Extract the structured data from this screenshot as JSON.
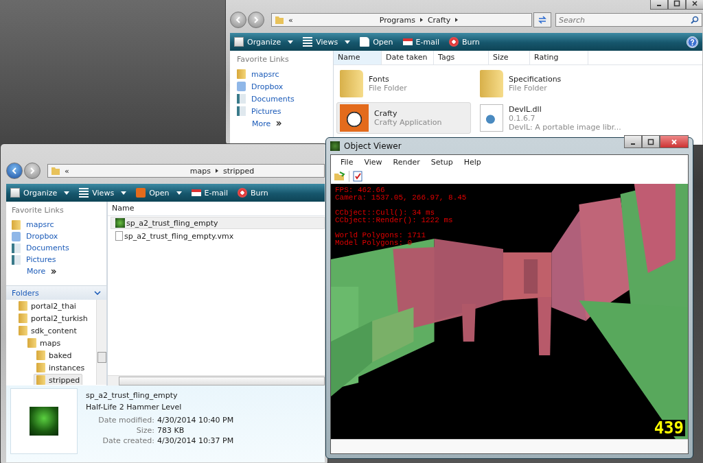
{
  "back_window": {
    "address": [
      "«",
      "Programs",
      "Crafty"
    ],
    "search": {
      "placeholder": "Search"
    },
    "toolbar": [
      {
        "label": "Organize",
        "kind": "organize",
        "dropdown": true
      },
      {
        "label": "Views",
        "kind": "views",
        "dropdown": true
      },
      {
        "label": "Open",
        "kind": "open",
        "dropdown": false
      },
      {
        "label": "E-mail",
        "kind": "email",
        "dropdown": false
      },
      {
        "label": "Burn",
        "kind": "burn",
        "dropdown": false
      }
    ],
    "favorite_links": {
      "title": "Favorite Links",
      "items": [
        {
          "label": "mapsrc",
          "kind": "folder"
        },
        {
          "label": "Dropbox",
          "kind": "dropbox"
        },
        {
          "label": "Documents",
          "kind": "documents"
        },
        {
          "label": "Pictures",
          "kind": "pictures"
        }
      ],
      "more": "More"
    },
    "columns": [
      "Name",
      "Date taken",
      "Tags",
      "Size",
      "Rating"
    ],
    "files": [
      {
        "name": "Fonts",
        "details": [
          "File Folder"
        ],
        "kind": "folder",
        "selected": false
      },
      {
        "name": "Specifications",
        "details": [
          "File Folder"
        ],
        "kind": "folder",
        "selected": false
      },
      {
        "name": "Crafty",
        "details": [
          "Crafty Application"
        ],
        "kind": "app",
        "selected": true
      },
      {
        "name": "DevIL.dll",
        "details": [
          "0.1.6.7",
          "DevIL: A portable image libr..."
        ],
        "kind": "dll",
        "selected": false
      }
    ]
  },
  "front_window": {
    "address": [
      "«",
      "maps",
      "stripped"
    ],
    "toolbar": [
      {
        "label": "Organize",
        "kind": "organize",
        "dropdown": true
      },
      {
        "label": "Views",
        "kind": "views",
        "dropdown": true
      },
      {
        "label": "Open",
        "kind": "app",
        "dropdown": true
      },
      {
        "label": "E-mail",
        "kind": "email",
        "dropdown": false
      },
      {
        "label": "Burn",
        "kind": "burn",
        "dropdown": false
      }
    ],
    "favorite_links": {
      "title": "Favorite Links",
      "items": [
        {
          "label": "mapsrc",
          "kind": "folder"
        },
        {
          "label": "Dropbox",
          "kind": "dropbox"
        },
        {
          "label": "Documents",
          "kind": "documents"
        },
        {
          "label": "Pictures",
          "kind": "pictures"
        }
      ],
      "more": "More"
    },
    "folders": {
      "title": "Folders",
      "items": [
        {
          "label": "portal2_thai",
          "selected": false
        },
        {
          "label": "portal2_turkish",
          "selected": false
        },
        {
          "label": "sdk_content",
          "selected": false,
          "children": [
            {
              "label": "maps",
              "selected": false,
              "children": [
                {
                  "label": "baked",
                  "selected": false
                },
                {
                  "label": "instances",
                  "selected": false
                },
                {
                  "label": "stripped",
                  "selected": true
                }
              ]
            }
          ]
        }
      ]
    },
    "columns": [
      "Name"
    ],
    "files": [
      {
        "name": "sp_a2_trust_fling_empty",
        "kind": "level",
        "selected": true
      },
      {
        "name": "sp_a2_trust_fling_empty.vmx",
        "kind": "file",
        "selected": false
      }
    ],
    "details_pane": {
      "name": "sp_a2_trust_fling_empty",
      "type": "Half-Life 2 Hammer Level",
      "fields": [
        {
          "label": "Date modified:",
          "value": "4/30/2014 10:40 PM"
        },
        {
          "label": "Size:",
          "value": "783 KB"
        },
        {
          "label": "Date created:",
          "value": "4/30/2014 10:37 PM"
        }
      ]
    }
  },
  "object_viewer": {
    "title": "Object Viewer",
    "menu": [
      "File",
      "View",
      "Render",
      "Setup",
      "Help"
    ],
    "overlay": [
      [
        "FPS: 462.66",
        "Camera: 1537.05, 266.97, 8.45"
      ],
      [
        "CCbject::Cull(): 34 ms",
        "CCbject::Render(): 1222 ms"
      ],
      [
        "World Polygons: 1711",
        "Model Polygons: 0"
      ]
    ],
    "counter": "439"
  }
}
